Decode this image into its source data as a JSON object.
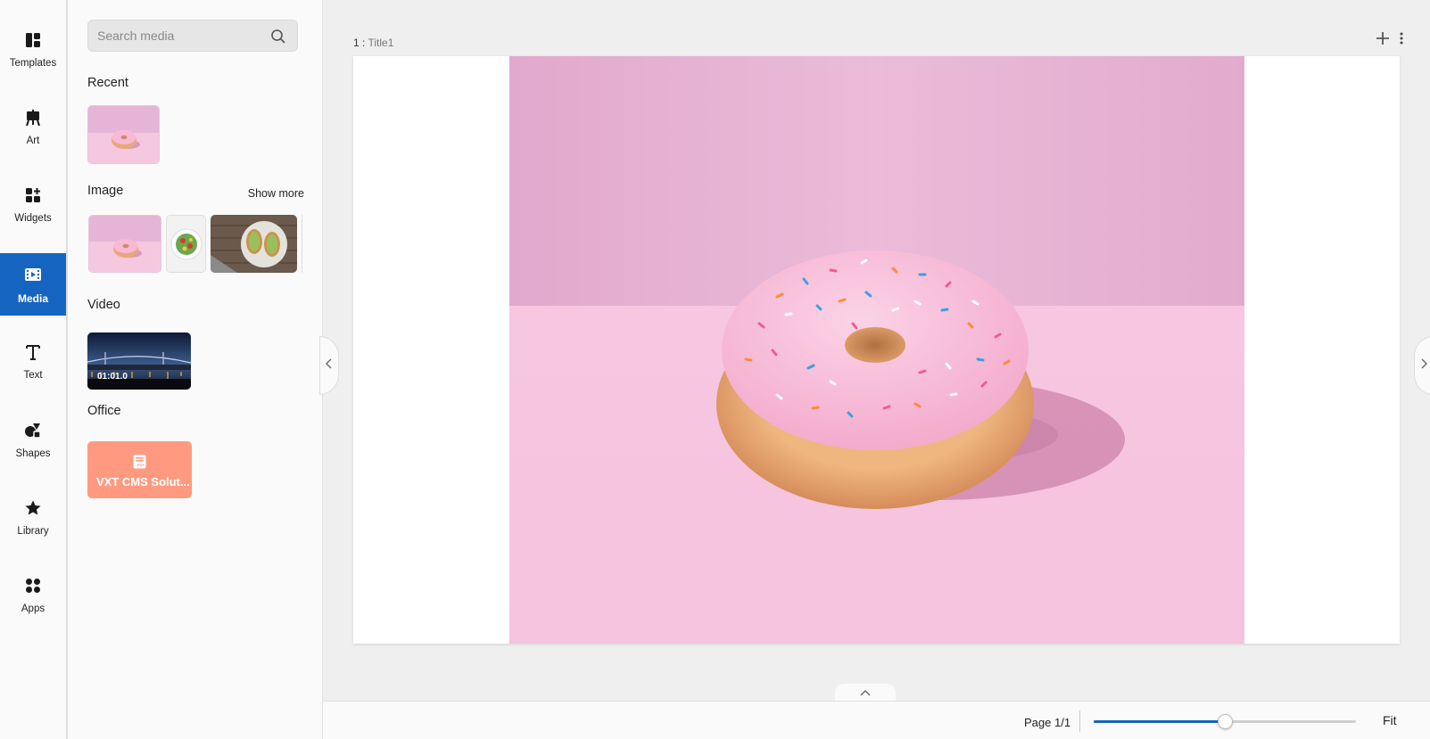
{
  "rail": {
    "items": [
      {
        "label": "Templates",
        "icon": "templates-icon",
        "active": false
      },
      {
        "label": "Art",
        "icon": "art-easel-icon",
        "active": false
      },
      {
        "label": "Widgets",
        "icon": "widgets-icon",
        "active": false
      },
      {
        "label": "Media",
        "icon": "media-icon",
        "active": true
      },
      {
        "label": "Text",
        "icon": "text-icon",
        "active": false
      },
      {
        "label": "Shapes",
        "icon": "shapes-icon",
        "active": false
      },
      {
        "label": "Library",
        "icon": "star-icon",
        "active": false
      },
      {
        "label": "Apps",
        "icon": "apps-icon",
        "active": false
      }
    ],
    "accent": "#1565c0"
  },
  "panel": {
    "search": {
      "placeholder": "Search media",
      "value": ""
    },
    "recent": {
      "title": "Recent"
    },
    "image": {
      "title": "Image",
      "show_more": "Show more"
    },
    "video": {
      "title": "Video",
      "duration": "01:01.0"
    },
    "office": {
      "title": "Office",
      "file_name": "VXT CMS Solut...",
      "file_badge": "PDF",
      "color": "#ff9a80"
    }
  },
  "canvas": {
    "slide_number": "1 :",
    "slide_title": "Title1"
  },
  "footer": {
    "page": "Page 1/1",
    "fit": "Fit",
    "zoom_fraction": 0.5
  }
}
